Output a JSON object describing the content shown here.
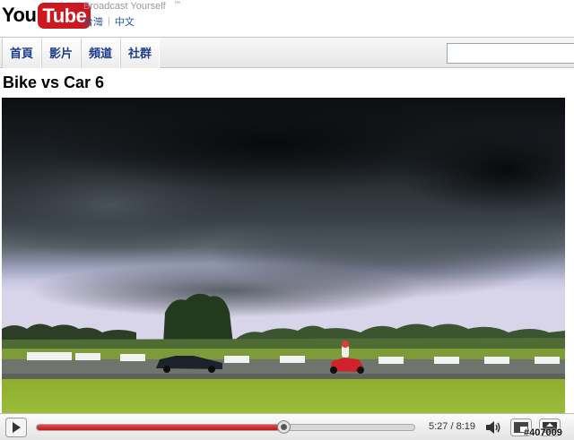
{
  "header": {
    "logo_you": "You",
    "logo_tube": "Tube",
    "tagline": "Broadcast Yourself",
    "trademark": "™",
    "locale_region": "台灣",
    "locale_language": "中文"
  },
  "nav": {
    "tabs": [
      {
        "label": "首頁"
      },
      {
        "label": "影片"
      },
      {
        "label": "頻道"
      },
      {
        "label": "社群"
      }
    ],
    "search_value": ""
  },
  "video": {
    "title": "Bike vs Car 6"
  },
  "player": {
    "time_current": "5:27",
    "time_total": "8:19",
    "time_display": "5:27 / 8:19",
    "progress_fraction": 0.655
  },
  "watermark": "#407009",
  "colors": {
    "brand_red": "#cc181e",
    "progress_red": "#cc2222",
    "nav_link": "#1c3c8c"
  },
  "icons": [
    "play-icon",
    "volume-icon",
    "size-toggle-icon",
    "fullscreen-icon"
  ]
}
